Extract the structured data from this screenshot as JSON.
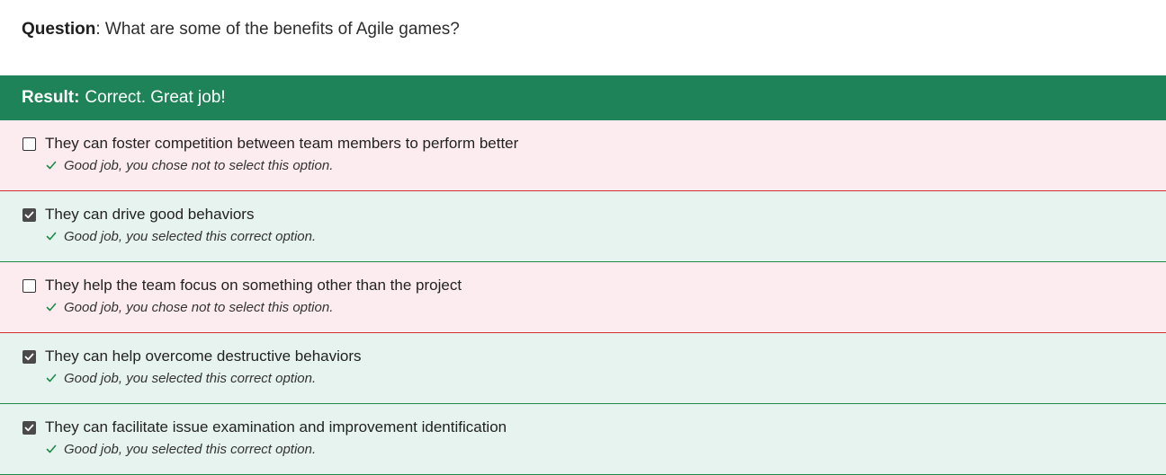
{
  "question": {
    "label": "Question",
    "separator": ":",
    "text": "What are some of the benefits of Agile games?"
  },
  "result": {
    "label": "Result:",
    "text": "Correct. Great job!",
    "color": "#1e8359"
  },
  "options": [
    {
      "text": "They can foster competition between team members to perform better",
      "checked": false,
      "feedback": "Good job, you chose not to select this option."
    },
    {
      "text": "They can drive good behaviors",
      "checked": true,
      "feedback": "Good job, you selected this correct option."
    },
    {
      "text": "They help the team focus on something other than the project",
      "checked": false,
      "feedback": "Good job, you chose not to select this option."
    },
    {
      "text": "They can help overcome destructive behaviors",
      "checked": true,
      "feedback": "Good job, you selected this correct option."
    },
    {
      "text": "They can facilitate issue examination and improvement identification",
      "checked": true,
      "feedback": "Good job, you selected this correct option."
    }
  ],
  "colors": {
    "incorrect_background": "#fdecef",
    "incorrect_border": "#d12e2e",
    "correct_background": "#e6f3ee",
    "correct_border": "#1e8a4a",
    "feedback_tick": "#1e8a4a"
  },
  "icons": {
    "checkbox_checked": "checkbox-checked-icon",
    "checkbox_unchecked": "checkbox-unchecked-icon",
    "feedback": "checkmark-icon"
  }
}
